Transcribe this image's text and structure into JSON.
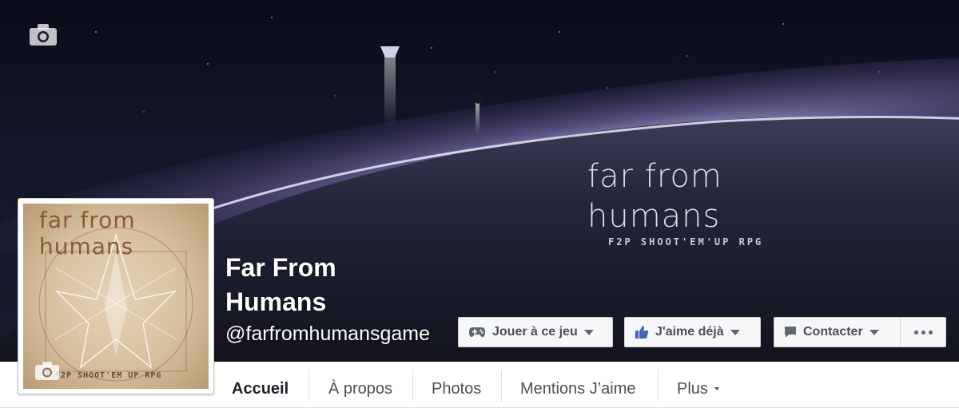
{
  "cover": {
    "camera_icon": "camera-icon",
    "logo_word": "far from humans",
    "logo_tag": "F2P SHOOT'EM'UP RPG"
  },
  "profile": {
    "logo_word": "far from humans",
    "logo_tag": "F2P  SHOOT'EM UP  RPG",
    "camera_icon": "camera-icon"
  },
  "page": {
    "name": "Far From Humans",
    "handle": "@farfromhumansgame"
  },
  "actions": {
    "play_label": "Jouer à ce jeu",
    "play_icon": "gamepad-icon",
    "like_label": "J'aime déjà",
    "like_icon": "thumbs-up-icon",
    "contact_label": "Contacter",
    "contact_icon": "message-icon",
    "more_icon": "ellipsis-icon"
  },
  "nav": {
    "tabs": [
      {
        "label": "Accueil",
        "active": true
      },
      {
        "label": "À propos",
        "active": false
      },
      {
        "label": "Photos",
        "active": false
      },
      {
        "label": "Mentions J’aime",
        "active": false
      },
      {
        "label": "Plus",
        "active": false
      }
    ]
  },
  "colors": {
    "like_blue": "#4267b2",
    "button_text": "#4b4f56",
    "button_bg": "#f6f7f9"
  }
}
